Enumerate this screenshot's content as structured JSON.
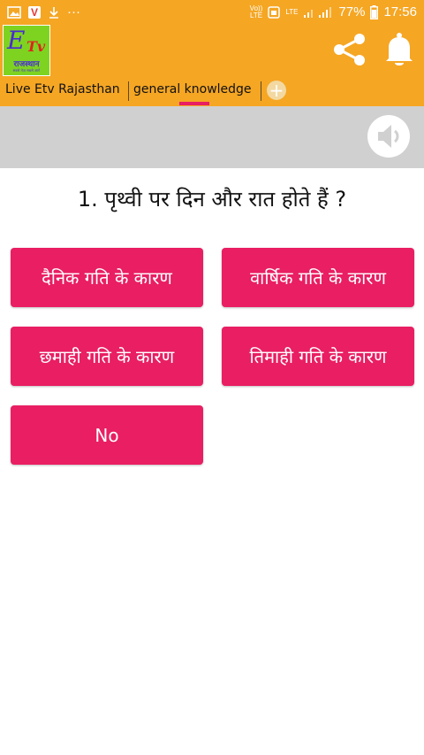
{
  "status": {
    "time": "17:56",
    "battery": "77%",
    "volte": "Vo))\nLTE",
    "lte": "LTE",
    "v_badge": "V",
    "dots": "···"
  },
  "app": {
    "logo": {
      "line1": "E",
      "line2": "Tv",
      "line3": "राजस्थान",
      "line4": "सबसे तेज़ सबसे आगे"
    },
    "icons": {
      "share": "share-icon",
      "bell": "bell-icon",
      "speaker": "speaker-icon"
    },
    "accent": "#f5a623",
    "button_color": "#e91e63"
  },
  "tabs": [
    {
      "label": "Live Etv Rajasthan"
    },
    {
      "label": "general knowledge",
      "active": true
    }
  ],
  "add_tab": "+",
  "question": "1. पृथ्वी पर दिन और रात होते हैं ?",
  "options": [
    "दैनिक गति के कारण",
    "वार्षिक गति के कारण",
    "छमाही गति के कारण",
    "तिमाही गति के कारण",
    "No"
  ]
}
